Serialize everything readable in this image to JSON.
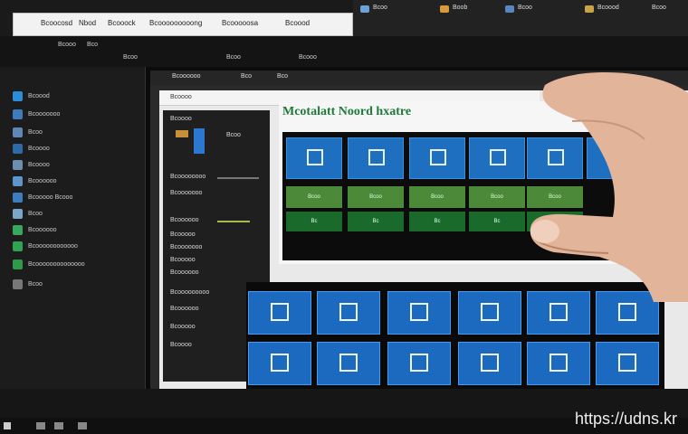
{
  "topbar": {
    "items": [
      "Bcoocosd",
      "Nbod",
      "Bcooock",
      "Bcooooooooong",
      "Bcooooosa",
      "Bcoood"
    ],
    "right_items": [
      "Bcoo",
      "Boob",
      "Bcoo",
      "Bcoood",
      "Bcoo"
    ]
  },
  "menubar": {
    "items": [
      "Bcooo",
      "Bco",
      "Bcoo",
      "Bcoo",
      "Bcooo"
    ]
  },
  "sidebar": {
    "items": [
      {
        "label": "Bcoood",
        "color": "#2c8ed6"
      },
      {
        "label": "Bcooooooo",
        "color": "#3d7bbd"
      },
      {
        "label": "Bcoo",
        "color": "#5f86b4"
      },
      {
        "label": "Bcoooo",
        "color": "#2d6aa8"
      },
      {
        "label": "Bcoooo",
        "color": "#6a8fb2"
      },
      {
        "label": "Bcoooooo",
        "color": "#5d94c9"
      },
      {
        "label": "Bcooooo Bcooo",
        "color": "#3c7ebd"
      },
      {
        "label": "Bcoo",
        "color": "#7aa6cc"
      },
      {
        "label": "Bcoooooo",
        "color": "#3aa760"
      },
      {
        "label": "Bcoooooooooooo",
        "color": "#2fa34f"
      },
      {
        "label": "Bcoooooooooooooo",
        "color": "#2e9a4a"
      },
      {
        "label": "Bcoo",
        "color": "#777777"
      }
    ]
  },
  "window": {
    "tabs": [
      "Bcoooooo",
      "Bco",
      "Bco"
    ],
    "head_label": "Bcoooo"
  },
  "panel": {
    "items": [
      "Bcoooo",
      "Bcoo",
      "Bcoooooooo",
      "Bcooooooo",
      "Bcoooooo",
      "Bcooooo",
      "Bcooooooo",
      "Bcooooo",
      "Bcoooooo",
      "Bcooooooooo",
      "Bcoooooo",
      "Bcooooo",
      "Bcoooo"
    ]
  },
  "app": {
    "title": "Mcotalatt Noord hxatre",
    "green_labels": [
      "Bcoo",
      "Bcoo",
      "Bcoo",
      "Bcoo",
      "Bcoo"
    ],
    "dark_labels": [
      "Bc",
      "Bc",
      "Bc",
      "Bc",
      "Bc"
    ]
  },
  "watermark": "https://udns.kr",
  "colors": {
    "tile_blue": "#1f6fc0",
    "tile_green": "#4c8a3a",
    "tile_dark_green": "#1a6a2c",
    "title_green": "#1f7a3a"
  }
}
